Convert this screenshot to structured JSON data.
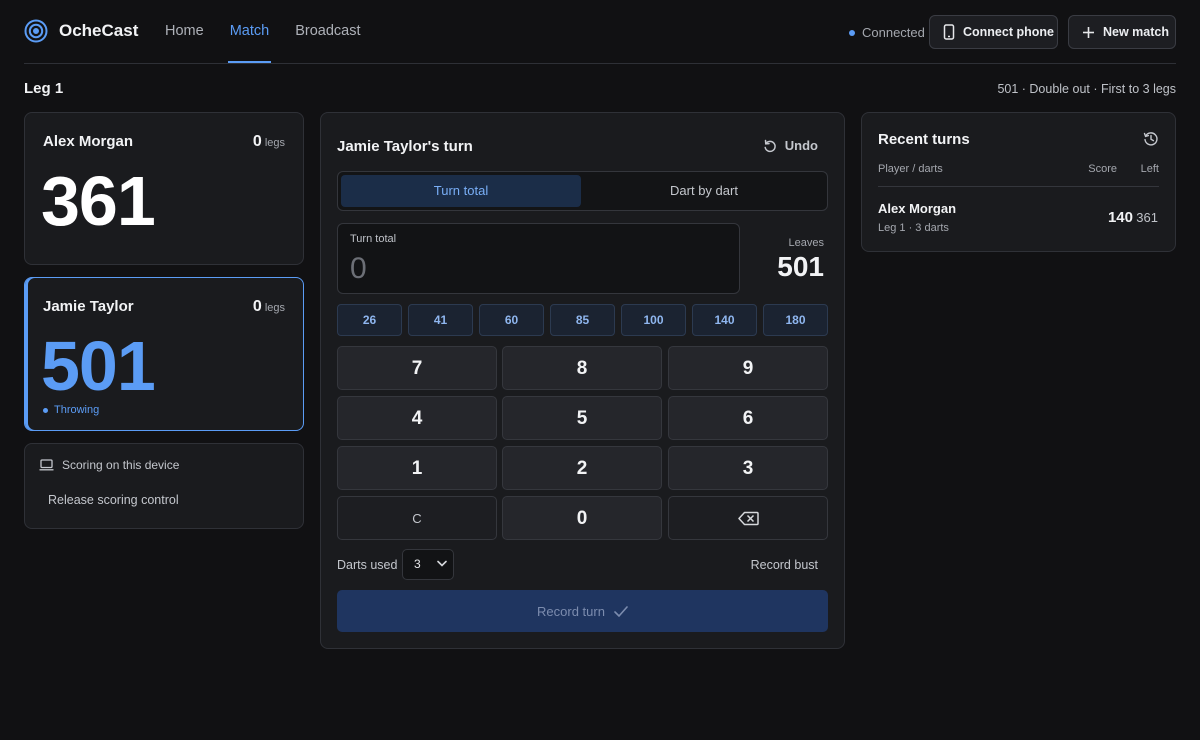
{
  "app": {
    "name": "OcheCast",
    "nav": [
      "Home",
      "Match",
      "Broadcast"
    ],
    "connection_status": "Connected",
    "connect_phone_label": "Connect phone",
    "new_match_label": "New match",
    "icons": {
      "logo": "target-icon",
      "phone": "phone-icon",
      "plus": "plus-icon"
    },
    "accent_color": "#5b9cf5"
  },
  "match": {
    "leg_title": "Leg 1",
    "info": "501 · Double out · First to 3 legs"
  },
  "players": [
    {
      "name": "Alex Morgan",
      "legs": "0",
      "legs_unit": "legs",
      "score": "361",
      "active": false
    },
    {
      "name": "Jamie Taylor",
      "legs": "0",
      "legs_unit": "legs",
      "score": "501",
      "active": true,
      "status": "Throwing"
    }
  ],
  "device": {
    "label": "Scoring on this device",
    "release_label": "Release scoring control",
    "icon": "laptop-icon"
  },
  "scorer": {
    "turn_title": "Jamie Taylor's turn",
    "undo_label": "Undo",
    "modes": [
      "Turn total",
      "Dart by dart"
    ],
    "selected_mode": "Turn total",
    "total_label": "Turn total",
    "total_value": "0",
    "leaves_label": "Leaves",
    "leaves_value": "501",
    "quick_scores": [
      "26",
      "41",
      "60",
      "85",
      "100",
      "140",
      "180"
    ],
    "keys": [
      "7",
      "8",
      "9",
      "4",
      "5",
      "6",
      "1",
      "2",
      "3",
      "C",
      "0"
    ],
    "backspace_icon": "backspace-icon",
    "darts_used_label": "Darts used",
    "darts_used_value": "3",
    "record_bust_label": "Record bust",
    "record_turn_label": "Record turn"
  },
  "recent": {
    "title": "Recent turns",
    "col_player": "Player / darts",
    "col_score": "Score",
    "col_left": "Left",
    "rows": [
      {
        "name": "Alex Morgan",
        "detail": "Leg 1 · 3 darts",
        "score": "140",
        "left": "361"
      }
    ]
  }
}
